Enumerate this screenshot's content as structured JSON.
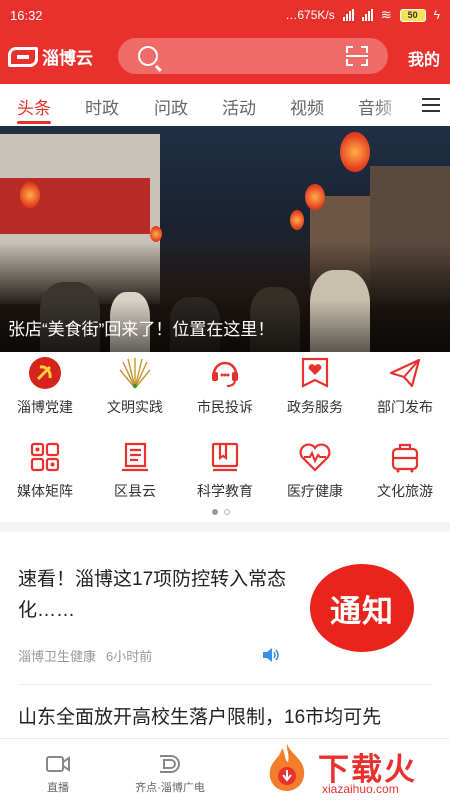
{
  "status": {
    "time": "16:32",
    "net_speed": "…675K/s",
    "battery": "50"
  },
  "header": {
    "logo_text": "淄博云",
    "mine_label": "我的"
  },
  "tabs": [
    "头条",
    "时政",
    "问政",
    "活动",
    "视频",
    "音频"
  ],
  "active_tab": "头条",
  "banner": {
    "caption": "张店“美食街”回来了！位置在这里！"
  },
  "grid": [
    {
      "label": "淄博党建",
      "icon": "party-emblem-icon"
    },
    {
      "label": "文明实践",
      "icon": "peacock-fan-icon"
    },
    {
      "label": "市民投诉",
      "icon": "headset-chat-icon"
    },
    {
      "label": "政务服务",
      "icon": "heart-badge-icon"
    },
    {
      "label": "部门发布",
      "icon": "paper-plane-icon"
    },
    {
      "label": "媒体矩阵",
      "icon": "matrix-grid-icon"
    },
    {
      "label": "区县云",
      "icon": "book-stack-icon"
    },
    {
      "label": "科学教育",
      "icon": "open-book-icon"
    },
    {
      "label": "医疗健康",
      "icon": "heart-pulse-icon"
    },
    {
      "label": "文化旅游",
      "icon": "suitcase-icon"
    }
  ],
  "news": [
    {
      "title": "速看！淄博这17项防控转入常态化……",
      "source": "淄博卫生健康",
      "time": "6小时前",
      "thumb_text": "通知"
    },
    {
      "title": "山东全面放开高校生落户限制，16市均可先"
    }
  ],
  "bottom_nav": [
    {
      "label": "直播",
      "icon": "video-camera-icon"
    },
    {
      "label": "齐点·淄博广电",
      "icon": "broadcast-logo-icon"
    }
  ],
  "watermark": {
    "big": "下载火",
    "small": "xiazaihuo.com"
  },
  "colors": {
    "brand_red": "#e8312d"
  }
}
